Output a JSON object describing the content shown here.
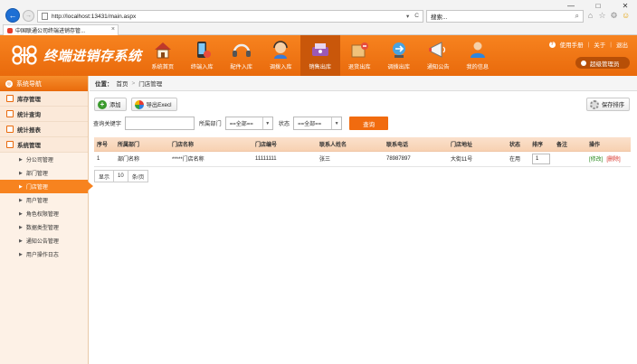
{
  "browser": {
    "url": "http://localhost:13431/main.aspx",
    "search_placeholder": "搜索...",
    "tab_title": "中国联通公司终端进销存管...",
    "tab_close": "×",
    "window_controls": [
      "—",
      "□",
      "✕"
    ],
    "address_tools": [
      "▾",
      "C"
    ],
    "search_glyph": "⌕",
    "toolbar_icons": [
      "home-icon",
      "star-icon",
      "gear-icon",
      "smiley-icon"
    ]
  },
  "header": {
    "title": "终端进销存系统",
    "links": {
      "help": "使用手册",
      "sep": "|",
      "about": "关于",
      "logout": "退出"
    },
    "user": "超级管理员",
    "nav": [
      {
        "label": "系统首页",
        "icon": "house-icon"
      },
      {
        "label": "终端入库",
        "icon": "phone-in-icon"
      },
      {
        "label": "配件入库",
        "icon": "headset-icon"
      },
      {
        "label": "调拨入库",
        "icon": "support-icon"
      },
      {
        "label": "销售出库",
        "icon": "sale-icon"
      },
      {
        "label": "退货出库",
        "icon": "return-icon"
      },
      {
        "label": "调拨出库",
        "icon": "transfer-icon"
      },
      {
        "label": "通知公告",
        "icon": "megaphone-icon"
      },
      {
        "label": "我的信息",
        "icon": "user-info-icon"
      }
    ],
    "active_nav": 4
  },
  "sidebar": {
    "title": "系统导航",
    "groups": [
      {
        "label": "库存管理"
      },
      {
        "label": "统计查询"
      },
      {
        "label": "统计报表"
      },
      {
        "label": "系统管理"
      }
    ],
    "items": [
      {
        "label": "分公司管理"
      },
      {
        "label": "部门管理"
      },
      {
        "label": "门店管理"
      },
      {
        "label": "用户管理"
      },
      {
        "label": "角色权限管理"
      },
      {
        "label": "数据类型管理"
      },
      {
        "label": "通知公告管理"
      },
      {
        "label": "用户操作日志"
      }
    ],
    "active_item": 2
  },
  "main": {
    "breadcrumb": {
      "label": "位置：",
      "home": "首页",
      "sep": ">",
      "current": "门店管理"
    },
    "toolbar": {
      "add": "添加",
      "export": "导出Execl",
      "save_sort": "保存排序"
    },
    "filters": {
      "keyword_label": "查询关键字",
      "keyword_value": "",
      "dept_label": "所属部门",
      "dept_value": "==全部==",
      "status_label": "状态",
      "status_value": "==全部==",
      "query": "查询"
    },
    "table": {
      "headers": [
        "序号",
        "所属部门",
        "门店名称",
        "门店编号",
        "联系人姓名",
        "联系电话",
        "门店地址",
        "状态",
        "排序",
        "备注",
        "操作"
      ],
      "rows": [
        {
          "no": "1",
          "dept": "部门名称",
          "name": "*****门店名称",
          "code": "11111111",
          "contact": "张三",
          "phone": "78987897",
          "address": "大街11号",
          "status": "在用",
          "sort": "1",
          "remark": "",
          "edit": "[修改]",
          "del": "[删除]"
        }
      ]
    },
    "pager": {
      "label": "显示",
      "size": "10",
      "unit": "条/页"
    }
  }
}
